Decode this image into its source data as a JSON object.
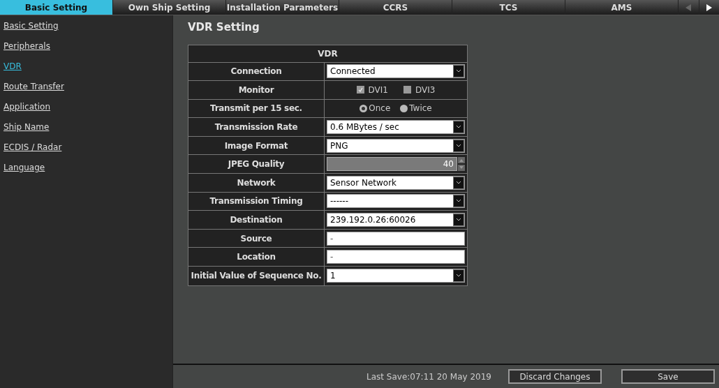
{
  "tabs": [
    {
      "label": "Basic Setting",
      "selected": true
    },
    {
      "label": "Own Ship Setting",
      "selected": false
    },
    {
      "label": "Installation Parameters",
      "selected": false
    },
    {
      "label": "CCRS",
      "selected": false
    },
    {
      "label": "TCS",
      "selected": false
    },
    {
      "label": "AMS",
      "selected": false
    }
  ],
  "tab_scroll": {
    "left_disabled": true,
    "right_disabled": false
  },
  "sidebar": {
    "items": [
      {
        "label": "Basic Setting",
        "selected": false
      },
      {
        "label": "Peripherals",
        "selected": false
      },
      {
        "label": "VDR",
        "selected": true
      },
      {
        "label": "Route Transfer",
        "selected": false
      },
      {
        "label": "Application",
        "selected": false
      },
      {
        "label": "Ship Name",
        "selected": false
      },
      {
        "label": "ECDIS / Radar",
        "selected": false
      },
      {
        "label": "Language",
        "selected": false
      }
    ]
  },
  "page_title": "VDR Setting",
  "table": {
    "title": "VDR",
    "rows": [
      {
        "label": "Connection",
        "kind": "select",
        "value": "Connected"
      },
      {
        "label": "Monitor",
        "kind": "checkboxes",
        "options": [
          {
            "label": "DVI1",
            "checked": true
          },
          {
            "label": "DVI3",
            "checked": false
          }
        ]
      },
      {
        "label": "Transmit per 15 sec.",
        "kind": "radios",
        "options": [
          {
            "label": "Once",
            "selected": true
          },
          {
            "label": "Twice",
            "selected": false
          }
        ]
      },
      {
        "label": "Transmission Rate",
        "kind": "select",
        "value": "0.6 MBytes / sec"
      },
      {
        "label": "Image Format",
        "kind": "select",
        "value": "PNG"
      },
      {
        "label": "JPEG Quality",
        "kind": "spinner",
        "value": "40",
        "disabled": true
      },
      {
        "label": "Network",
        "kind": "select",
        "value": "Sensor Network"
      },
      {
        "label": "Transmission Timing",
        "kind": "select",
        "value": "------"
      },
      {
        "label": "Destination",
        "kind": "select",
        "value": "239.192.0.26:60026"
      },
      {
        "label": "Source",
        "kind": "text",
        "value": "-"
      },
      {
        "label": "Location",
        "kind": "text",
        "value": "-"
      },
      {
        "label": "Initial Value of Sequence No.",
        "kind": "select",
        "value": "1"
      }
    ]
  },
  "status_bar": {
    "last_save": "Last Save:07:11 20 May 2019",
    "buttons": [
      "Discard Changes",
      "Save"
    ]
  }
}
